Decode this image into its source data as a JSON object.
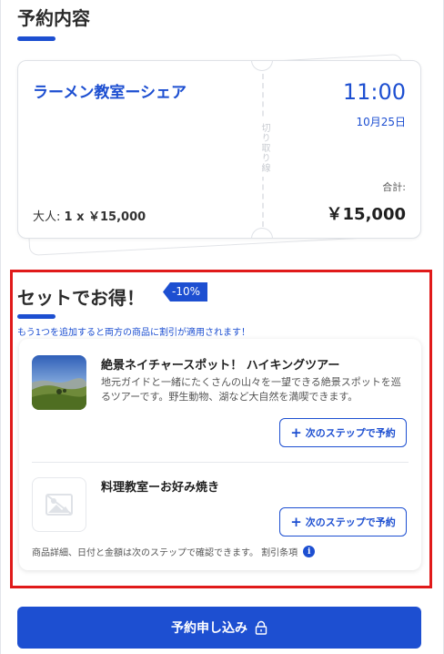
{
  "reservation": {
    "title": "予約内容",
    "ticket": {
      "name": "ラーメン教室ーシェア",
      "time": "11:00",
      "date": "10月25日",
      "tear_label": "切り取り線",
      "qty_label": "大人:",
      "qty_value": "1 x ￥15,000",
      "total_label": "合計:",
      "total_value": "￥15,000"
    }
  },
  "offer": {
    "title": "セットでお得！",
    "discount": "-10%",
    "subtitle": "もう1つを追加すると両方の商品に割引が適用されます！",
    "items": [
      {
        "title": "絶景ネイチャースポット！ ハイキングツアー",
        "description": "地元ガイドと一緒にたくさんの山々を一望できる絶景スポットを巡るツアーです。野生動物、湖など大自然を満喫できます。",
        "button_label": "次のステップで予約",
        "icon": "plus-icon"
      },
      {
        "title": "料理教室ーお好み焼き",
        "button_label": "次のステップで予約",
        "icon": "image-placeholder-icon"
      }
    ],
    "note": "商品詳細、日付と金額は次のステップで確認できます。 割引条項",
    "info_icon": "i"
  },
  "submit": {
    "label": "予約申し込み",
    "icon": "lock-icon"
  },
  "colors": {
    "accent": "#1d4fd1",
    "highlight_frame": "#e01a1a"
  }
}
